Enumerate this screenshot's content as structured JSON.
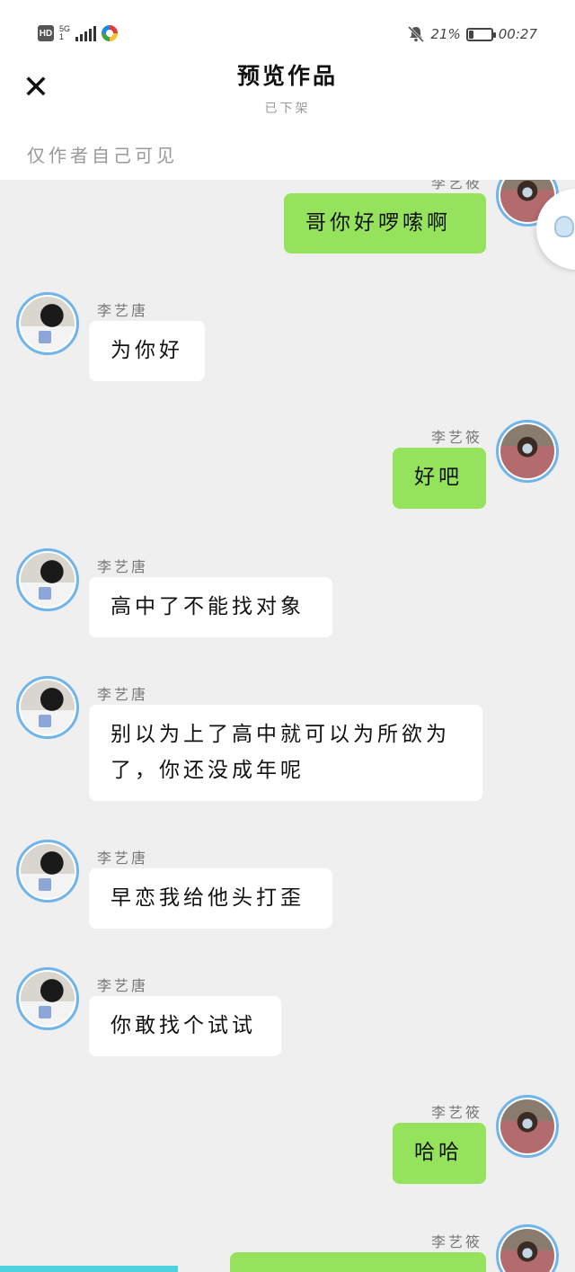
{
  "status_bar": {
    "hd": "HD",
    "network": "5G",
    "network_sub": "1",
    "battery_percent": "21%",
    "battery_level": 0.21,
    "time": "00:27"
  },
  "header": {
    "close_glyph": "✕",
    "title": "预览作品",
    "subtitle": "已下架",
    "visibility": "仅作者自己可见"
  },
  "messages": [
    {
      "side": "right",
      "sender": "李艺筱",
      "text": "哥你好啰嗦啊"
    },
    {
      "side": "left",
      "sender": "李艺唐",
      "text": "为你好"
    },
    {
      "side": "right",
      "sender": "李艺筱",
      "text": "好吧"
    },
    {
      "side": "left",
      "sender": "李艺唐",
      "text": "高中了不能找对象"
    },
    {
      "side": "left",
      "sender": "李艺唐",
      "text": "别以为上了高中就可以为所欲为了，你还没成年呢"
    },
    {
      "side": "left",
      "sender": "李艺唐",
      "text": "早恋我给他头打歪"
    },
    {
      "side": "left",
      "sender": "李艺唐",
      "text": "你敢找个试试"
    },
    {
      "side": "right",
      "sender": "李艺筱",
      "text": "哈哈"
    },
    {
      "side": "right",
      "sender": "李艺筱",
      "text": ""
    }
  ],
  "icons": {
    "close": "close-icon",
    "bell_off": "bell-off-icon",
    "battery": "battery-icon",
    "signal": "signal-icon",
    "float": "qq-chat-icon"
  },
  "colors": {
    "left_bubble": "#ffffff",
    "right_bubble": "#95e35d",
    "avatar_ring": "#6fb4ea",
    "background": "#efefef"
  }
}
